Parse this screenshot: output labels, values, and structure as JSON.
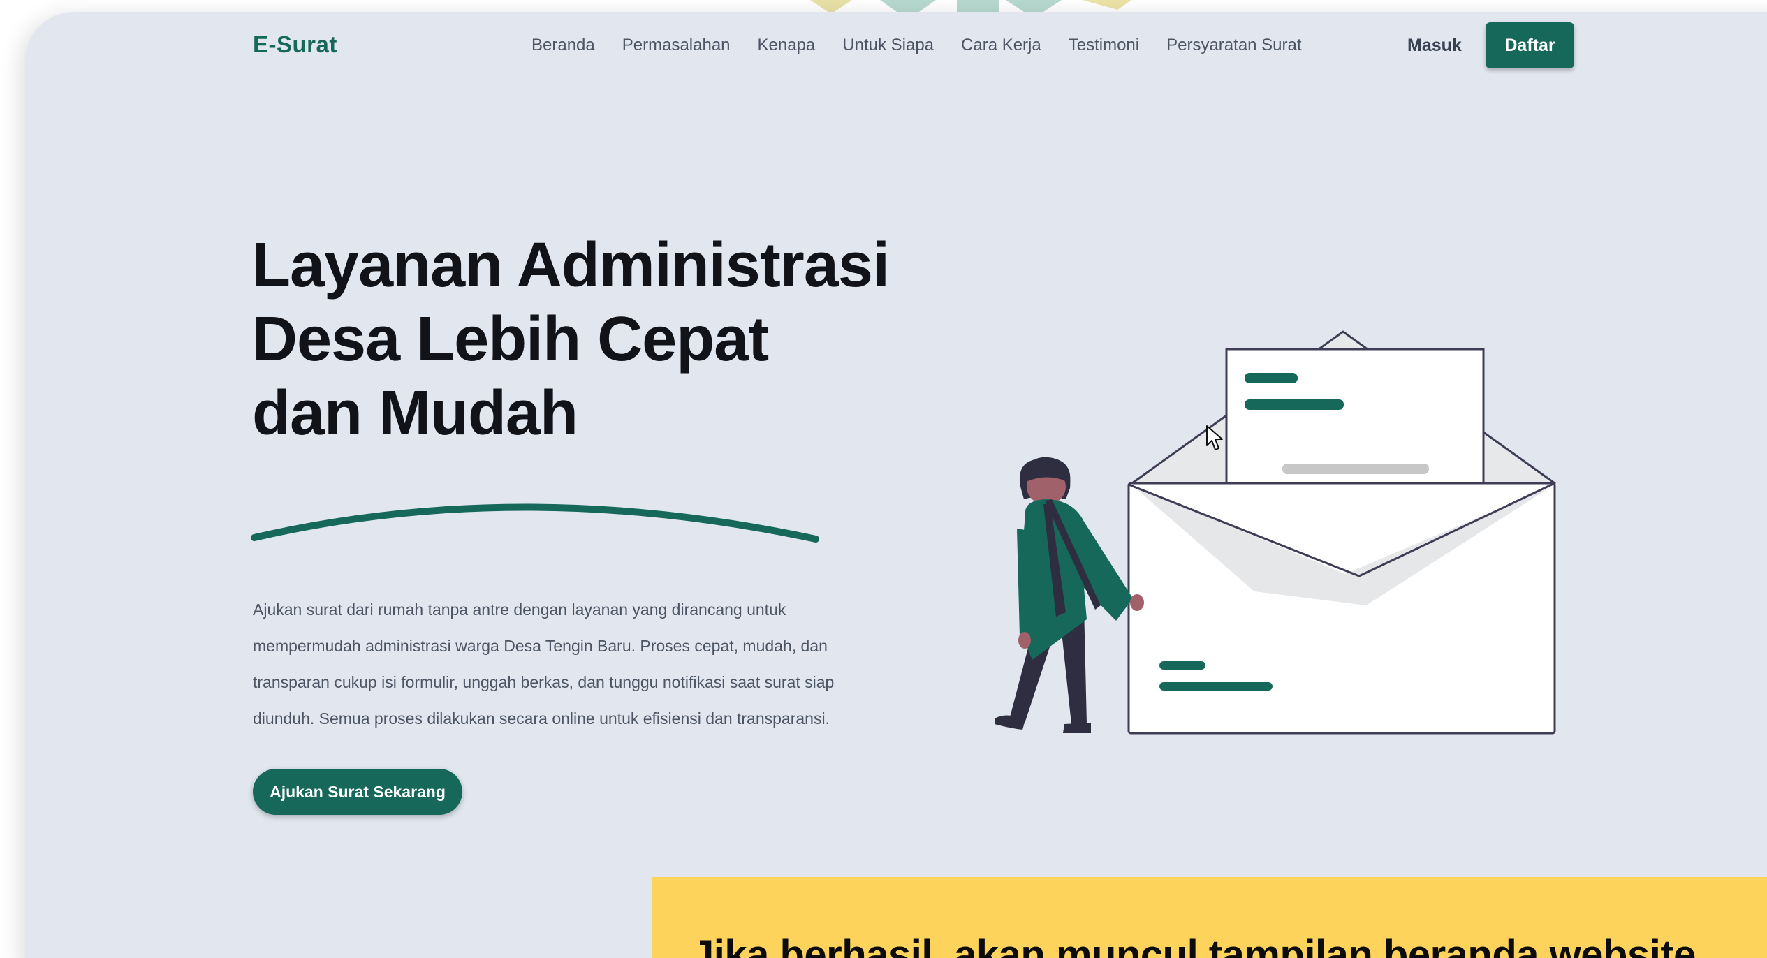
{
  "brand": {
    "name": "E-Surat",
    "primary_color": "#15685a"
  },
  "nav": {
    "links": [
      "Beranda",
      "Permasalahan",
      "Kenapa",
      "Untuk Siapa",
      "Cara Kerja",
      "Testimoni",
      "Persyaratan Surat"
    ],
    "login_label": "Masuk",
    "register_label": "Daftar"
  },
  "hero": {
    "title_lines": [
      "Layanan Administrasi",
      "Desa Lebih Cepat",
      "dan Mudah"
    ],
    "description_lines": [
      "Ajukan surat dari rumah tanpa antre dengan layanan yang dirancang untuk",
      "mempermudah administrasi warga Desa Tengin Baru. Proses cepat, mudah, dan",
      "transparan cukup isi formulir, unggah berkas, dan tunggu notifikasi saat surat siap",
      "diunduh. Semua proses dilakukan secara online untuk efisiensi dan transparansi."
    ],
    "cta_label": "Ajukan Surat Sekarang",
    "illustration": "person-with-open-envelope-illustration"
  },
  "caption": {
    "text": "Jika berhasil, akan muncul tampilan beranda website",
    "background_color": "#fdd35b"
  }
}
